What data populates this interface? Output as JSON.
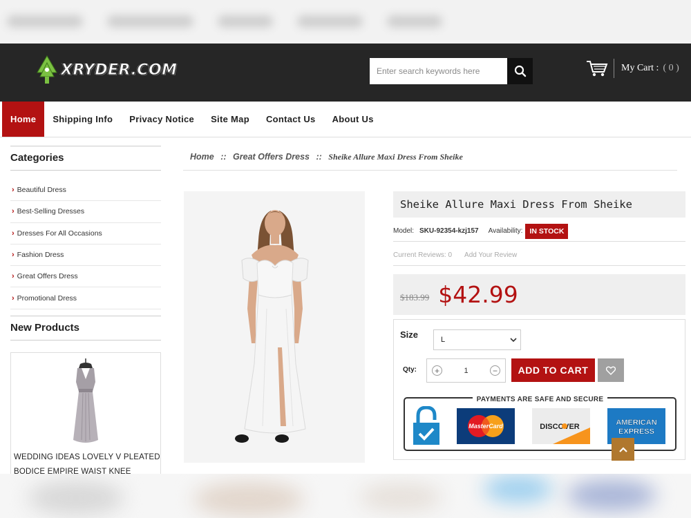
{
  "header": {
    "logo_text": "XRYDER.COM",
    "search_placeholder": "Enter search keywords here",
    "cart_label": "My Cart :",
    "cart_count": "( 0 )"
  },
  "nav": {
    "items": [
      "Home",
      "Shipping Info",
      "Privacy Notice",
      "Site Map",
      "Contact Us",
      "About Us"
    ],
    "active": "Home"
  },
  "sidebar": {
    "categories_title": "Categories",
    "categories": [
      "Beautiful Dress",
      "Best-Selling Dresses",
      "Dresses For All Occasions",
      "Fashion Dress",
      "Great Offers Dress",
      "Promotional Dress"
    ],
    "new_products_title": "New Products",
    "new_product_title_line1": "WEDDING IDEAS LOVELY V PLEATED",
    "new_product_title_line2": "BODICE EMPIRE WAIST KNEE"
  },
  "breadcrumb": {
    "home": "Home",
    "sep1": "::",
    "category": "Great Offers Dress",
    "sep2": "::",
    "current": "Sheike Allure Maxi Dress From Sheike"
  },
  "product": {
    "title": "Sheike Allure Maxi Dress From Sheike",
    "model_label": "Model:",
    "model": "SKU-92354-kzj157",
    "availability_label": "Availability:",
    "availability": "IN STOCK",
    "reviews_label": "Current Reviews: 0",
    "add_review": "Add Your Review",
    "old_price": "$183.99",
    "price": "$42.99",
    "size_label": "Size",
    "size_value": "L",
    "qty_label": "Qty:",
    "qty": "1",
    "add_to_cart": "ADD TO CART",
    "secure_title": "PAYMENTS ARE SAFE AND SECURE",
    "payment_icons": [
      "lock-icon",
      "mastercard-icon",
      "discover-icon",
      "american-express-icon"
    ],
    "mastercard_text": "MasterCard",
    "discover_text": "DISCOVER",
    "amex_text_1": "AMERICAN",
    "amex_text_2": "EXPRESS"
  },
  "colors": {
    "brand_red": "#b31212",
    "header_bg": "#262626",
    "back_to_top": "#b0782e"
  }
}
